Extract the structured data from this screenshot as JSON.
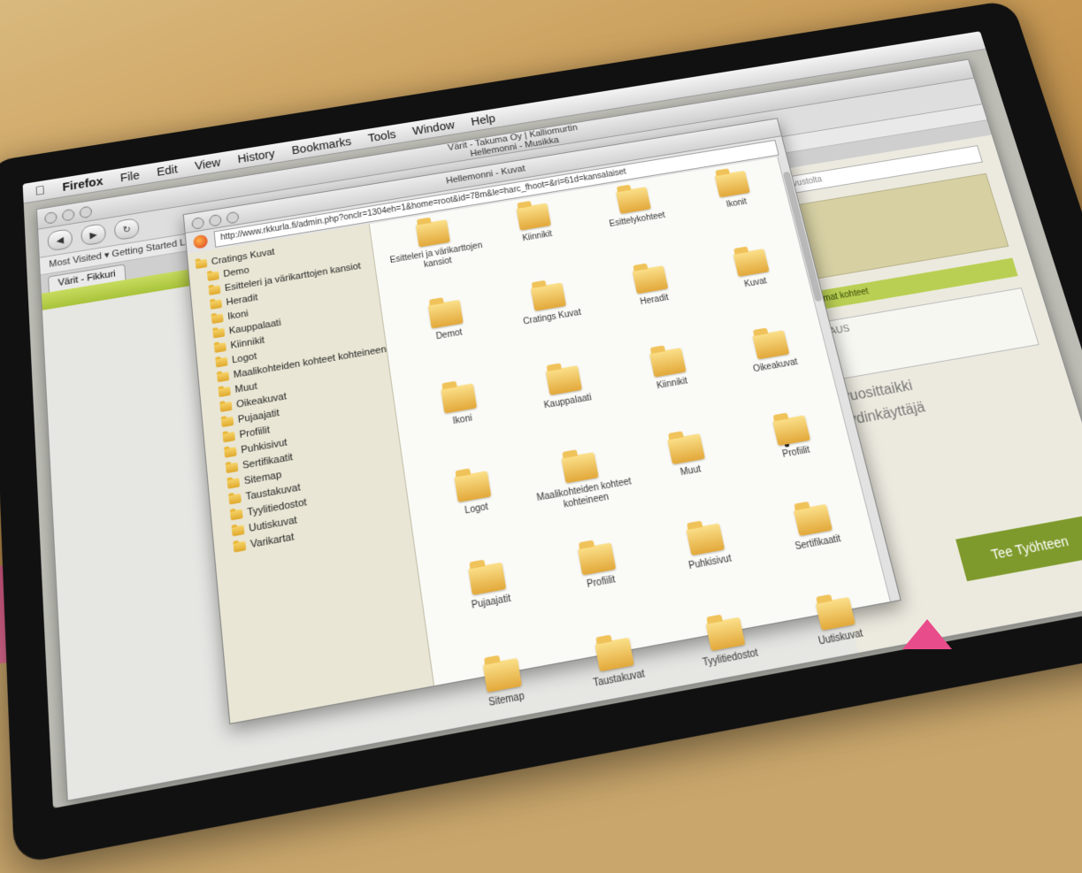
{
  "menubar": {
    "apple_icon": "apple-icon",
    "app": "Firefox",
    "items": [
      "File",
      "Edit",
      "View",
      "History",
      "Bookmarks",
      "Tools",
      "Window",
      "Help"
    ]
  },
  "back_window": {
    "title_lines": [
      "Värit - Takuma Oy | Kalliomurtin",
      "Hellemonni - Musikka",
      "Hellemonni - Kuvat"
    ],
    "bookmarks_text": "Most Visited ▾   Getting Started   Latest Headlines",
    "tab_label": "Värit - Fikkuri",
    "site": {
      "search_placeholder": "Hae sivustolta",
      "green_bar": "Uusimmat kohteet",
      "text1": "Tee vuosittaikki",
      "text2": "Etsi ydinkäyttäjä",
      "cta": "Tee Työhteen",
      "box_text": "VASTAUS"
    }
  },
  "front_window": {
    "title": "Hellemonni - Kuvat",
    "url": "http://www.rkkurla.fi/admin.php?onclr=1304eh=1&home=root&id=78m&le=harc_fhoot=&ri=61d=kansalaiset",
    "tree": [
      "Cratings Kuvat",
      "Demo",
      "Esitteleri ja värikarttojen kansiot",
      "Heradit",
      "Ikoni",
      "Kauppalaati",
      "Kiinnikit",
      "Logot",
      "Maalikohteiden kohteet kohteineen",
      "Muut",
      "Oikeakuvat",
      "Pujaajatit",
      "Profiilit",
      "Puhkisivut",
      "Sertifikaatit",
      "Sitemap",
      "Taustakuvat",
      "Tyylitiedostot",
      "Uutiskuvat",
      "Varikartat"
    ],
    "folders": [
      "Esitteleri ja värikarttojen kansiot",
      "Kiinnikit",
      "Esittelykohteet",
      "Ikonit",
      "Demot",
      "Cratings Kuvat",
      "Heradit",
      "Kuvat",
      "Ikoni",
      "Kauppalaati",
      "Kiinnikit",
      "Oikeakuvat",
      "Logot",
      "Maalikohteiden kohteet kohteineen",
      "Muut",
      "Profiilit",
      "Pujaajatit",
      "Profiilit",
      "Puhkisivut",
      "Sertifikaatit",
      "Sitemap",
      "Taustakuvat",
      "Tyylitiedostot",
      "Uutiskuvat"
    ]
  }
}
